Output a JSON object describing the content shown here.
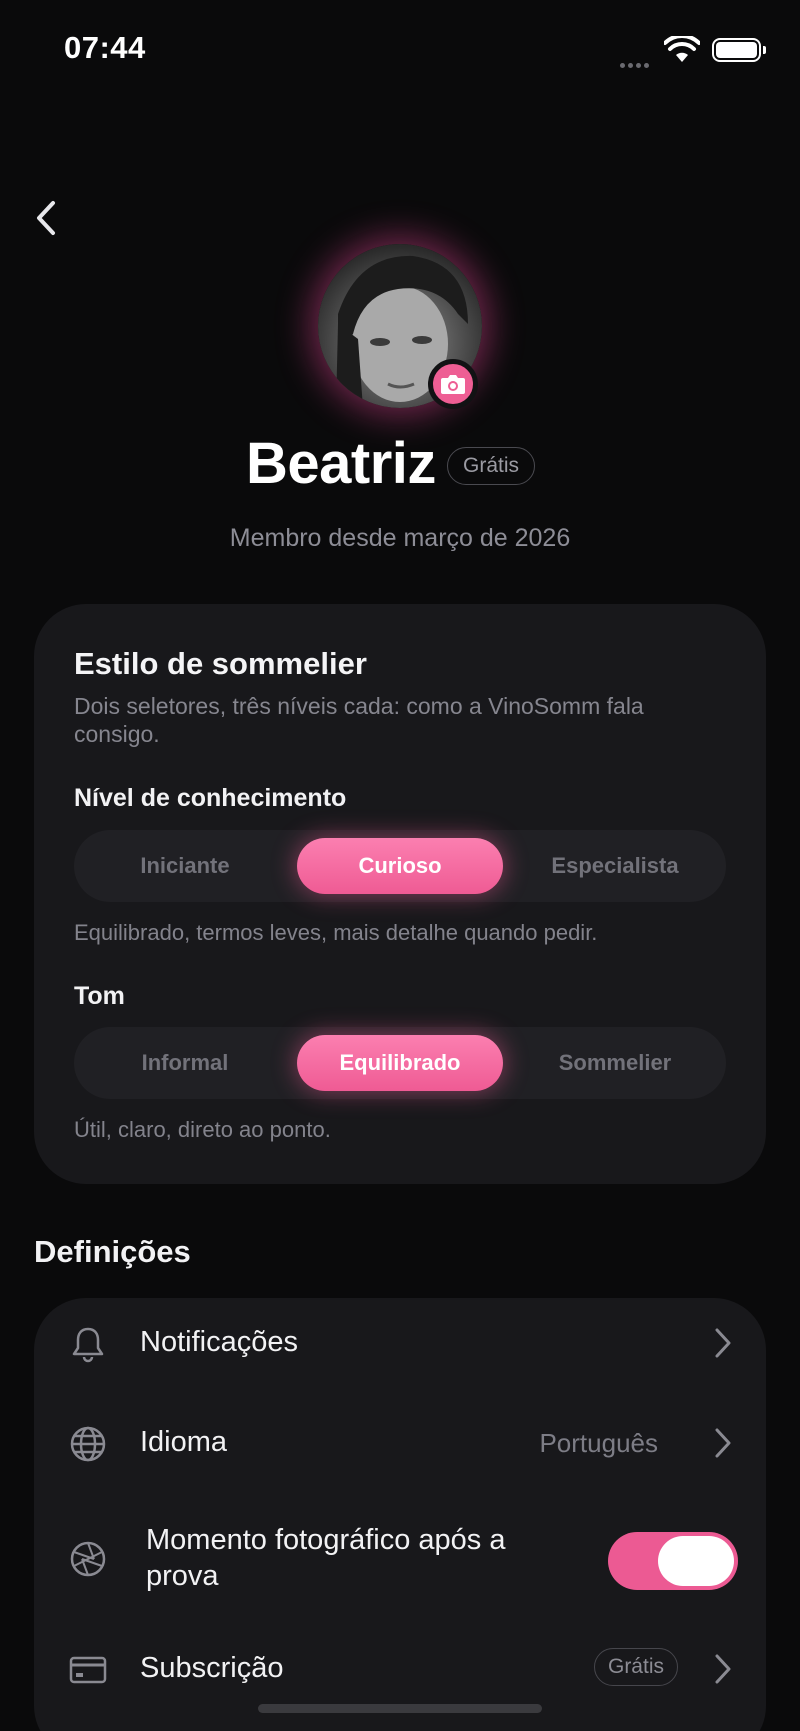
{
  "status_bar": {
    "time": "07:44"
  },
  "profile": {
    "name": "Beatriz",
    "plan_badge": "Grátis",
    "member_since": "Membro desde março de 2026"
  },
  "sommelier_style": {
    "title": "Estilo de sommelier",
    "description": "Dois seletores, três níveis cada: como a VinoSomm fala consigo.",
    "knowledge": {
      "label": "Nível de conhecimento",
      "options": [
        "Iniciante",
        "Curioso",
        "Especialista"
      ],
      "selected": "Curioso",
      "help": "Equilibrado, termos leves, mais detalhe quando pedir."
    },
    "tone": {
      "label": "Tom",
      "options": [
        "Informal",
        "Equilibrado",
        "Sommelier"
      ],
      "selected": "Equilibrado",
      "help": "Útil, claro, direto ao ponto."
    }
  },
  "settings": {
    "header": "Definições",
    "rows": [
      {
        "label": "Notificações",
        "icon": "bell-icon"
      },
      {
        "label": "Idioma",
        "value": "Português",
        "icon": "globe-icon"
      },
      {
        "label": "Momento fotográfico após a prova",
        "icon": "aperture-icon",
        "toggle": true
      },
      {
        "label": "Subscrição",
        "badge": "Grátis",
        "icon": "credit-card-icon"
      }
    ]
  },
  "colors": {
    "accent": "#EF5B94",
    "background": "#0A0A0B",
    "card": "#18181B"
  }
}
